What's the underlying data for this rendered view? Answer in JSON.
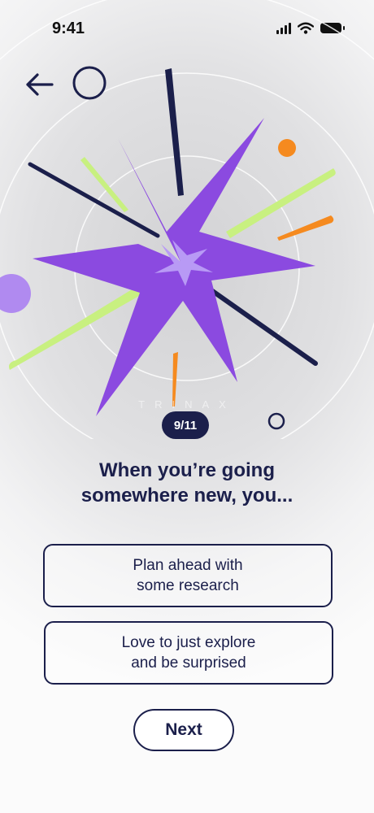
{
  "status_bar": {
    "time": "9:41",
    "icons": [
      "cellular-signal-icon",
      "wifi-icon",
      "battery-icon"
    ]
  },
  "navigation": {
    "back_icon": "arrow-left-icon"
  },
  "illustration": {
    "watermark": "TRINAX",
    "colors": {
      "starburst_outer": "#8b4ae0",
      "starburst_inner": "#b89af5",
      "navy": "#1b1f4b",
      "lime": "#c8f080",
      "orange": "#f58a1f",
      "lavender": "#b08af0"
    }
  },
  "progress": {
    "label": "9/11",
    "current": 9,
    "total": 11
  },
  "question": {
    "text": "When you’re going\nsomewhere new, you..."
  },
  "options": [
    {
      "label": "Plan ahead with\nsome research"
    },
    {
      "label": "Love to just explore\nand be surprised"
    }
  ],
  "next_button": {
    "label": "Next"
  }
}
